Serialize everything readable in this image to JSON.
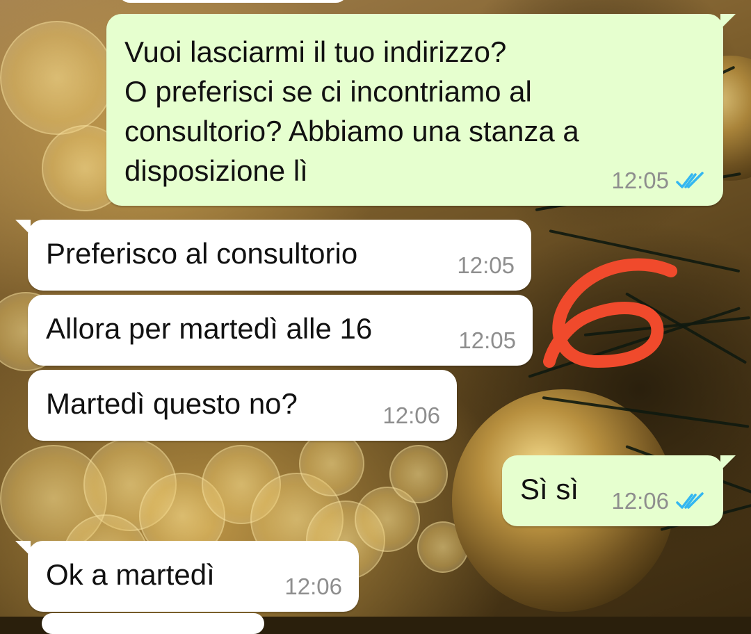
{
  "messages": [
    {
      "id": "m1",
      "direction": "outgoing",
      "text": "Vuoi lasciarmi il tuo indirizzo?\nO preferisci se ci incontriamo al\nconsultorio? Abbiamo una stanza a\ndisposizione lì",
      "time": "12:05",
      "status": "read"
    },
    {
      "id": "m2",
      "direction": "incoming",
      "text": "Preferisco al consultorio",
      "time": "12:05"
    },
    {
      "id": "m3",
      "direction": "incoming",
      "text": "Allora per martedì alle 16",
      "time": "12:05"
    },
    {
      "id": "m4",
      "direction": "incoming",
      "text": "Martedì questo no?",
      "time": "12:06"
    },
    {
      "id": "m5",
      "direction": "outgoing",
      "text": "Sì sì",
      "time": "12:06",
      "status": "read"
    },
    {
      "id": "m6",
      "direction": "incoming",
      "text": "Ok a martedì",
      "time": "12:06"
    }
  ],
  "annotation": {
    "drawn_text": "6",
    "color": "#f04a2c"
  },
  "colors": {
    "outgoing_bubble": "#e6ffcf",
    "incoming_bubble": "#ffffff",
    "read_ticks": "#34b7f1",
    "timestamp": "#8e8e8e"
  },
  "icons": {
    "read_receipt": "double-check-icon"
  }
}
